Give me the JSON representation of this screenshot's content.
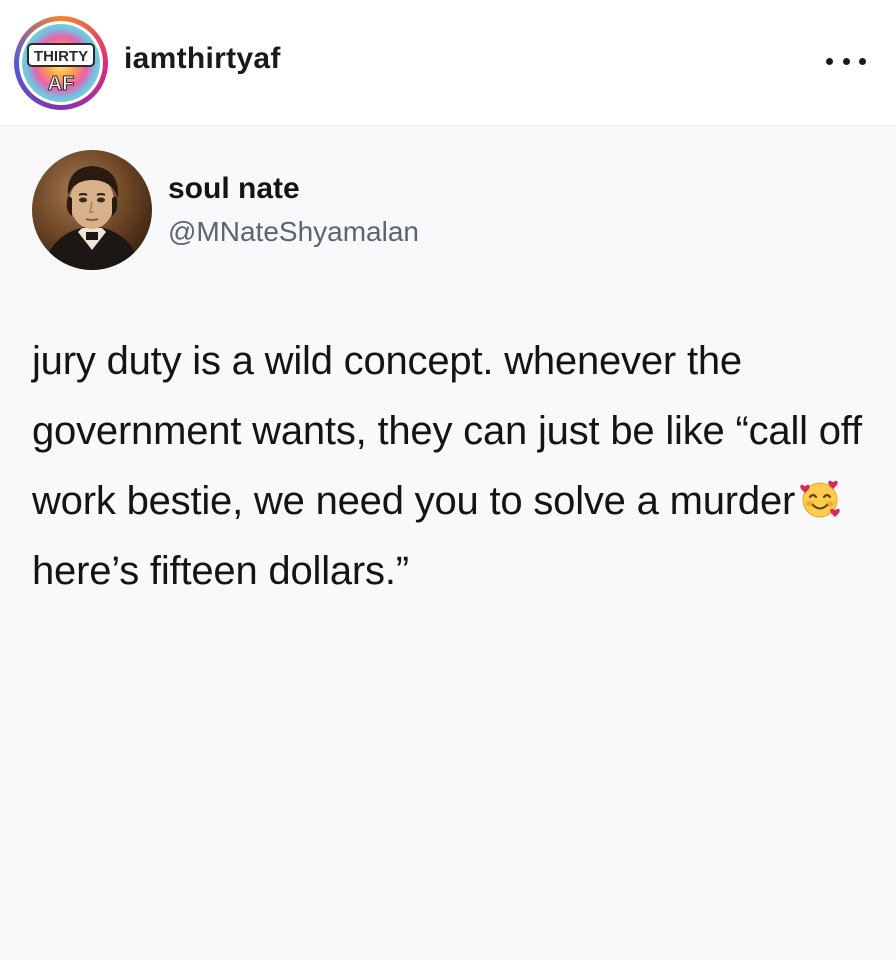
{
  "post_header": {
    "username": "iamthirtyaf",
    "avatar_text_top": "THIRTY",
    "avatar_text_bottom": "AF",
    "more_icon": "ellipsis-icon"
  },
  "tweet": {
    "display_name": "soul nate",
    "handle": "@MNateShyamalan",
    "text_part1": "jury duty is a wild concept. whenever the government wants, they can just be like “call off work bestie, we need you to solve a murder",
    "emoji": "smiling-face-with-hearts",
    "text_part2": "here’s fifteen dollars.”"
  },
  "colors": {
    "background": "#fbfbfd",
    "text": "#141414",
    "handle": "#5b6570"
  }
}
